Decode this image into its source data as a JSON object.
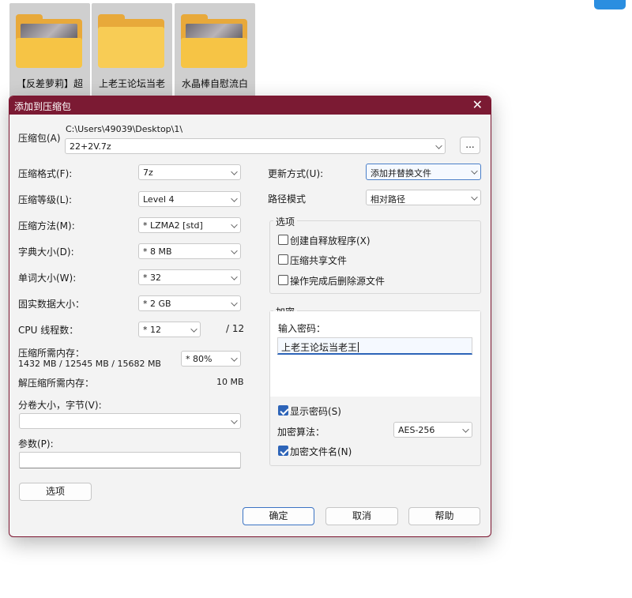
{
  "desktop": {
    "folders": [
      {
        "label": "【反差萝莉】超"
      },
      {
        "label": "上老王论坛当老"
      },
      {
        "label": "水晶棒自慰流白"
      }
    ]
  },
  "dialog": {
    "title": "添加到压缩包",
    "close_glyph": "✕",
    "archive_label": "压缩包(A)",
    "archive_path": "C:\\Users\\49039\\Desktop\\1\\",
    "archive_name": "22+2V.7z",
    "browse_label": "...",
    "format": {
      "label": "压缩格式(F):",
      "value": "7z"
    },
    "level": {
      "label": "压缩等级(L):",
      "value": "Level 4"
    },
    "method": {
      "label": "压缩方法(M):",
      "value": "* LZMA2 [std]"
    },
    "dict": {
      "label": "字典大小(D):",
      "value": "* 8 MB"
    },
    "word": {
      "label": "单词大小(W):",
      "value": "* 32"
    },
    "solid": {
      "label": "固实数据大小：",
      "value": "* 2 GB"
    },
    "threads": {
      "label": "CPU 线程数：",
      "value": "* 12",
      "max": "/ 12"
    },
    "mem_compress": {
      "label": "压缩所需内存：",
      "detail": "1432 MB / 12545 MB / 15682 MB",
      "value": "* 80%"
    },
    "mem_decompress": {
      "label": "解压缩所需内存：",
      "value": "10 MB"
    },
    "split": {
      "label": "分卷大小，字节(V):",
      "value": ""
    },
    "params": {
      "label": "参数(P):",
      "value": ""
    },
    "options_button": "选项",
    "update_mode": {
      "label": "更新方式(U):",
      "value": "添加并替换文件"
    },
    "path_mode": {
      "label": "路径模式",
      "value": "相对路径"
    },
    "options_group": {
      "title": "选项",
      "items": [
        {
          "label": "创建自释放程序(X)",
          "checked": false
        },
        {
          "label": "压缩共享文件",
          "checked": false
        },
        {
          "label": "操作完成后删除源文件",
          "checked": false
        }
      ]
    },
    "encryption": {
      "title": "加密",
      "password_label": "输入密码：",
      "password_value": "上老王论坛当老王",
      "show_password": "显示密码(S)",
      "method_label": "加密算法：",
      "method_value": "AES-256",
      "encrypt_names": "加密文件名(N)"
    },
    "buttons": {
      "ok": "确定",
      "cancel": "取消",
      "help": "帮助"
    }
  }
}
